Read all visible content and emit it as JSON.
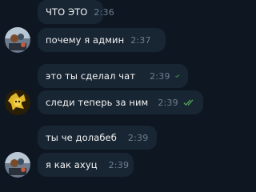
{
  "messages": [
    {
      "text": "что это",
      "time": "2:36"
    },
    {
      "text": "почему я админ",
      "time": "2:37"
    },
    {
      "text": "это ты сделал чат",
      "time": "2:39",
      "read": true
    },
    {
      "text": "следи теперь за ним",
      "time": "2:39",
      "read": true
    },
    {
      "text": "ты че долабеб",
      "time": "2:39"
    },
    {
      "text": "я как ахуц",
      "time": "2:39"
    }
  ],
  "colors": {
    "background": "#0e1621",
    "bubble": "#182533",
    "text": "#f5f5f5",
    "time": "#6d7f8f",
    "read_ticks": "#4fae4e"
  },
  "icons": [
    "user-avatar-icon",
    "double-check-icon"
  ]
}
